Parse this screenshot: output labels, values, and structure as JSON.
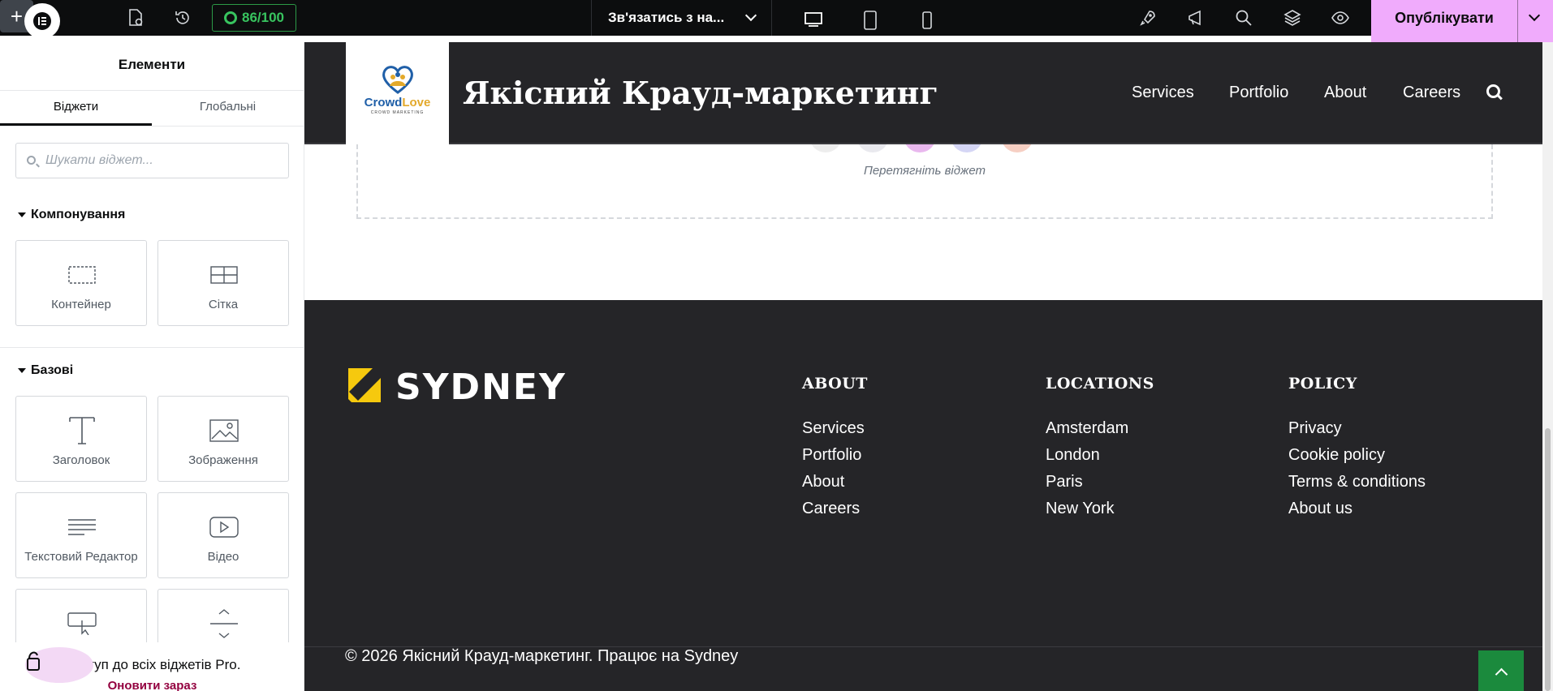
{
  "topbar": {
    "score": "86/100",
    "page_selector": "Зв'язатись з на...",
    "publish_label": "Опублікувати"
  },
  "sidebar": {
    "title": "Елементи",
    "tabs": [
      "Віджети",
      "Глобальні"
    ],
    "search_placeholder": "Шукати віджет...",
    "categories": [
      {
        "label": "Компонування",
        "widgets": [
          "Контейнер",
          "Сітка"
        ]
      },
      {
        "label": "Базові",
        "widgets": [
          "Заголовок",
          "Зображення",
          "Текстовий Редактор",
          "Відео"
        ]
      }
    ],
    "promo": {
      "text": "Доступ до всіх віджетів Pro.",
      "link": "Оновити зараз"
    }
  },
  "site": {
    "logo_brand": {
      "crowd": "Crowd",
      "love": "Love",
      "sub": "CROWD MARKETING"
    },
    "title": "Якісний Крауд-маркетинг",
    "nav": [
      "Services",
      "Portfolio",
      "About",
      "Careers"
    ],
    "dropzone_hint": "Перетягніть віджет",
    "footer": {
      "logo_word": "SYDNEY",
      "columns": [
        {
          "heading": "ABOUT",
          "items": [
            "Services",
            "Portfolio",
            "About",
            "Careers"
          ]
        },
        {
          "heading": "LOCATIONS",
          "items": [
            "Amsterdam",
            "London",
            "Paris",
            "New York"
          ]
        },
        {
          "heading": "POLICY",
          "items": [
            "Privacy",
            "Cookie policy",
            "Terms & conditions",
            "About us"
          ]
        }
      ],
      "copyright": "© 2026 Якісний Крауд-маркетинг. Працює на Sydney"
    }
  }
}
